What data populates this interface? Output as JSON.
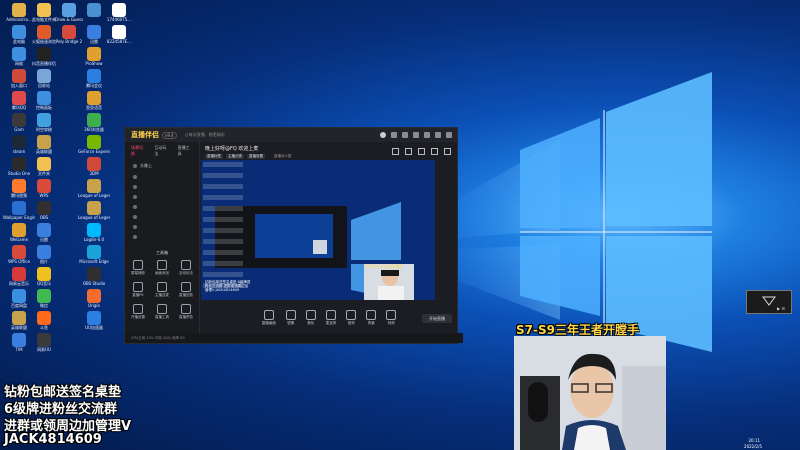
{
  "desktop": {
    "icons": [
      {
        "label": "Administra...",
        "color": "#e1b24a"
      },
      {
        "label": "此电脑文件夹",
        "color": "#f0c050"
      },
      {
        "label": "Draw & Guess",
        "color": "#5aa0e0"
      },
      {
        "label": "",
        "color": "#4a90d0"
      },
      {
        "label": "17446075...",
        "color": "#ffffff"
      },
      {
        "label": "此电脑",
        "color": "#3f8fe0"
      },
      {
        "label": "火狐极速浏览",
        "color": "#e05a2a"
      },
      {
        "label": "Poly Bridge 2",
        "color": "#d84a3a"
      },
      {
        "label": "迅雷",
        "color": "#3a7fe0"
      },
      {
        "label": "8224587E...",
        "color": "#ffffff"
      },
      {
        "label": "网络",
        "color": "#3f8fe0"
      },
      {
        "label": "抖音直播伴侣",
        "color": "#222222"
      },
      {
        "label": "ProShow",
        "color": "#e0a030"
      },
      {
        "label": "加入窗口",
        "color": "#d04a3a"
      },
      {
        "label": "回收站",
        "color": "#7aa7d8"
      },
      {
        "label": "腾讯会议",
        "color": "#2a7fe0"
      },
      {
        "label": "腾讯QQ",
        "color": "#e04a4a"
      },
      {
        "label": "控制面板",
        "color": "#3f8fe0"
      },
      {
        "label": "歪歪语音",
        "color": "#e0a030"
      },
      {
        "label": "Gam",
        "color": "#3a3a3a"
      },
      {
        "label": "时空穿梭",
        "color": "#40a0e0"
      },
      {
        "label": "360浏览器",
        "color": "#3fae4f"
      },
      {
        "label": "steam",
        "color": "#1b2838"
      },
      {
        "label": "英雄联盟",
        "color": "#c8a24a"
      },
      {
        "label": "GeForce Experience",
        "color": "#76b900"
      },
      {
        "label": "Studio One",
        "color": "#2a2a2a"
      },
      {
        "label": "文件夹",
        "color": "#f0c050"
      },
      {
        "label": "3DM",
        "color": "#d04a3a"
      },
      {
        "label": "腾讯视频",
        "color": "#ff7a2a"
      },
      {
        "label": "WPS",
        "color": "#d84a3a"
      },
      {
        "label": "League of Legends",
        "color": "#c8a24a"
      },
      {
        "label": "Wallpaper Engine",
        "color": "#2a6fd0"
      },
      {
        "label": "OBS",
        "color": "#302e31"
      },
      {
        "label": "League of Legends",
        "color": "#c8a24a"
      },
      {
        "label": "WeGame",
        "color": "#e0a030"
      },
      {
        "label": "迅雷",
        "color": "#3a7fe0"
      },
      {
        "label": "LogiBr-6.0",
        "color": "#00b8fc"
      },
      {
        "label": "WPS Office",
        "color": "#d84a3a"
      },
      {
        "label": "图片",
        "color": "#3a7fe0"
      },
      {
        "label": "Microsoft Edge",
        "color": "#1ba2d8"
      },
      {
        "label": "网易云音乐",
        "color": "#d83a3a"
      },
      {
        "label": "QQ音乐",
        "color": "#f0c020"
      },
      {
        "label": "OBS Studio",
        "color": "#302e31"
      },
      {
        "label": "百度网盘",
        "color": "#3a8fe0"
      },
      {
        "label": "微信",
        "color": "#3fb950"
      },
      {
        "label": "Origin",
        "color": "#f56c2d"
      },
      {
        "label": "英雄联盟",
        "color": "#c8a24a"
      },
      {
        "label": "斗鱼",
        "color": "#ff6a1a"
      },
      {
        "label": "UU加速器",
        "color": "#2a7fe0"
      },
      {
        "label": "TIM",
        "color": "#3a7fe0"
      },
      {
        "label": "网易UU",
        "color": "#3a3a3a"
      }
    ]
  },
  "app": {
    "name": "直播伴侣",
    "version": "v9.4",
    "topbar_text": "让每次直播，都更精彩",
    "sidebar_tabs": [
      "场景切换",
      "互动玩法",
      "直播工具"
    ],
    "sidebar_items": [
      "头像上",
      "",
      "",
      "",
      "",
      "",
      "",
      "",
      "",
      "",
      "窗口3",
      "窗口5"
    ],
    "section_title": "工具箱",
    "tools": [
      {
        "label": "屏幕捕获"
      },
      {
        "label": "画面添加"
      },
      {
        "label": "互动玩法"
      },
      {
        "label": "直播PK"
      },
      {
        "label": "主播连麦"
      },
      {
        "label": "直播回放"
      },
      {
        "label": "开播设置"
      },
      {
        "label": "直播工具"
      },
      {
        "label": "直播预告"
      }
    ],
    "stream": {
      "title": "晚上好呀@FQ 欢迎上麦",
      "tags": [
        "直播标签",
        "主播分类",
        "直播设置"
      ],
      "stats": "直播间人数"
    },
    "bottom_buttons": [
      "直播画面",
      "镜像",
      "美化",
      "麦克风",
      "音效",
      "背景",
      "特效",
      "开播"
    ],
    "live_button": "开始直播",
    "status_text": "CPU占用 12%  内存 40%  帧率 60"
  },
  "preview": {
    "caption": "S7-S9三年王者开膛手",
    "mini_text": "钻粉包邮送签名桌垫 6级牌进粉丝交流群 进群或领周边加管理V JACK4814609"
  },
  "overlay": {
    "lines": [
      "钻粉包邮送签名桌垫",
      "6级牌进粉丝交流群",
      "进群或领周边加管理V",
      "JACK4814609"
    ],
    "camera_caption": "S7-S9三年王者开膛手"
  },
  "tray": {
    "time": "20:11",
    "date": "2022/2/5"
  }
}
